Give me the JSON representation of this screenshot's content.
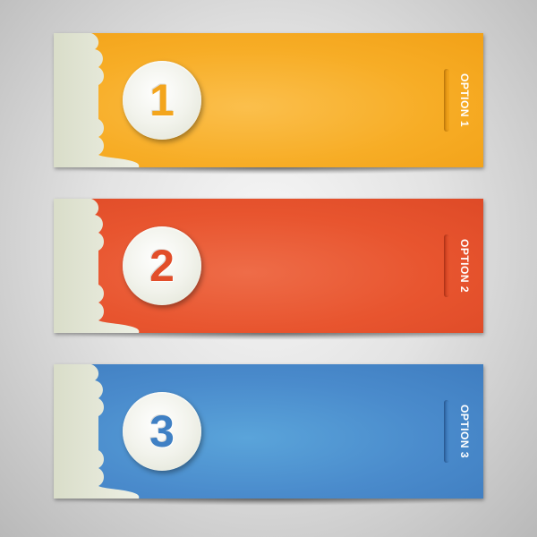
{
  "banners": [
    {
      "number": "1",
      "label": "OPTION 1",
      "color": "#f7ad26",
      "number_color": "#f3a51d"
    },
    {
      "number": "2",
      "label": "OPTION 2",
      "color": "#e8552f",
      "number_color": "#e24e2a"
    },
    {
      "number": "3",
      "label": "OPTION 3",
      "color": "#4a8bcc",
      "number_color": "#3f80c4"
    }
  ],
  "panel_color": "#e3e6d6"
}
